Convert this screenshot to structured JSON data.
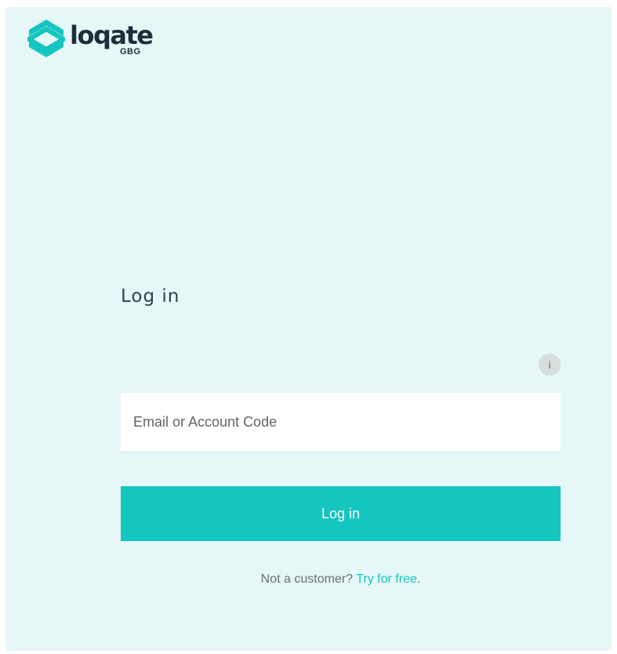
{
  "brand": {
    "name": "loqate",
    "sub": "GBG",
    "logo_icon": "loqate-diamond-logo-icon",
    "accent_color": "#14c6bf",
    "background_color": "#e5f7f7"
  },
  "form": {
    "title": "Log in",
    "info_icon": "info-icon",
    "info_glyph": "i",
    "email_placeholder": "Email or Account Code",
    "email_value": "",
    "submit_label": "Log in"
  },
  "signup": {
    "prompt": "Not a customer? ",
    "link_label": "Try for free",
    "trailing": "."
  }
}
